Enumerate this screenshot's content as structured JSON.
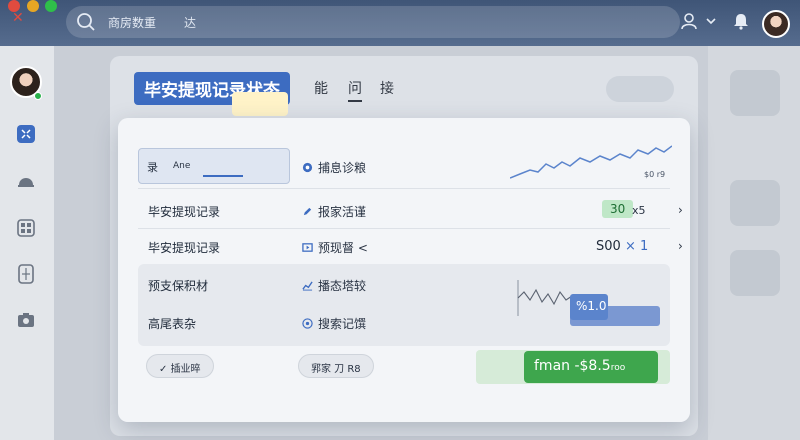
{
  "topbar": {
    "search_text": "商房数重",
    "search_tab": "达",
    "icons": [
      "close-icon",
      "search-icon",
      "user-icon",
      "chevron-down-icon",
      "bell-icon"
    ]
  },
  "rail": {
    "icons": [
      "apps-icon",
      "cloud-icon",
      "grid-icon",
      "calculator-icon",
      "camera-icon"
    ]
  },
  "page": {
    "title": "毕安提现记录状态",
    "tabs": [
      "能",
      "问",
      "接"
    ]
  },
  "card": {
    "input": {
      "label": "录",
      "value": "Ane"
    },
    "rows": [
      {
        "col1": "",
        "col2": "捕息诊粮",
        "col2_icon": "gear-icon"
      },
      {
        "col1": "毕安提现记录",
        "col2": "报家活谨",
        "col2_icon": "edit-icon"
      },
      {
        "col1": "毕安提现记录",
        "col2": "预现督 <",
        "col2_icon": "window-icon"
      },
      {
        "col1": "预支保积材",
        "col2": "播态塔较",
        "col2_icon": "chart-icon"
      },
      {
        "col1": "高尾表杂",
        "col2": "搜索记馔",
        "col2_icon": "target-icon"
      }
    ],
    "spark_label": "$0 r9",
    "badge_value": "30",
    "badge_suffix": "x5",
    "amount": "S00",
    "amount_mult": "× 1",
    "tag_value": "%1.0",
    "footer": {
      "left_button": "插业晬",
      "mid_button": "郛家 刀 R8",
      "primary_button": "fman -$8.5",
      "primary_button_suffix": "roo"
    },
    "colors": {
      "accent": "#3d6cc1",
      "success": "#3ea64d"
    }
  }
}
